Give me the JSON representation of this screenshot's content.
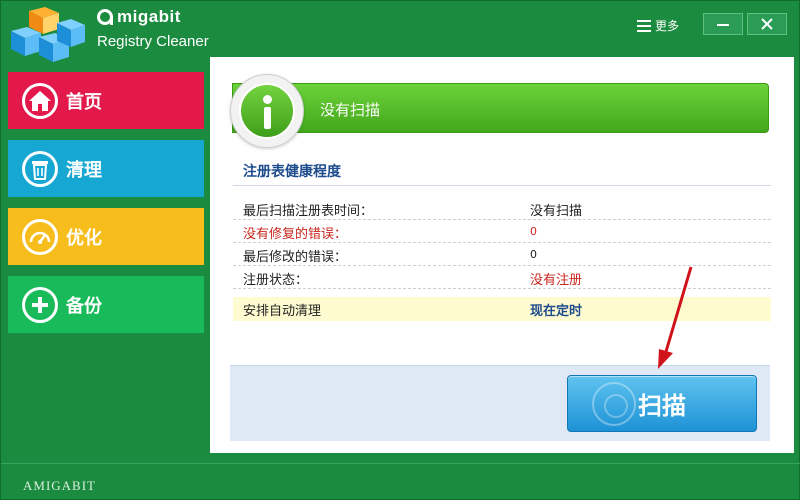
{
  "app": {
    "brand": "migabit",
    "product": "Registry Cleaner",
    "more_label": "更多",
    "footer_brand": "AMIGABIT"
  },
  "sidebar": {
    "items": [
      {
        "label": "首页",
        "icon": "home-icon",
        "color": "#e3194c"
      },
      {
        "label": "清理",
        "icon": "trash-icon",
        "color": "#16a7d3"
      },
      {
        "label": "优化",
        "icon": "gauge-icon",
        "color": "#f6bd1c"
      },
      {
        "label": "备份",
        "icon": "plus-circle-icon",
        "color": "#19ba59"
      }
    ]
  },
  "status": {
    "banner": "没有扫描"
  },
  "health": {
    "title": "注册表健康程度",
    "rows": [
      {
        "label": "最后扫描注册表时间：",
        "value": "没有扫描"
      },
      {
        "label": "没有修复的错误：",
        "value": "0"
      },
      {
        "label": "最后修改的错误：",
        "value": "0"
      },
      {
        "label": "注册状态：",
        "value": "没有注册"
      }
    ],
    "schedule_label": "安排自动清理",
    "schedule_action": "现在定时"
  },
  "scan": {
    "button_label": "扫描"
  },
  "colors": {
    "window": "#1b8b3f",
    "accent_red": "#c9261d",
    "link_blue": "#1e4c8c",
    "banner_green": "#43a81c",
    "scan_blue": "#1e92d6"
  }
}
